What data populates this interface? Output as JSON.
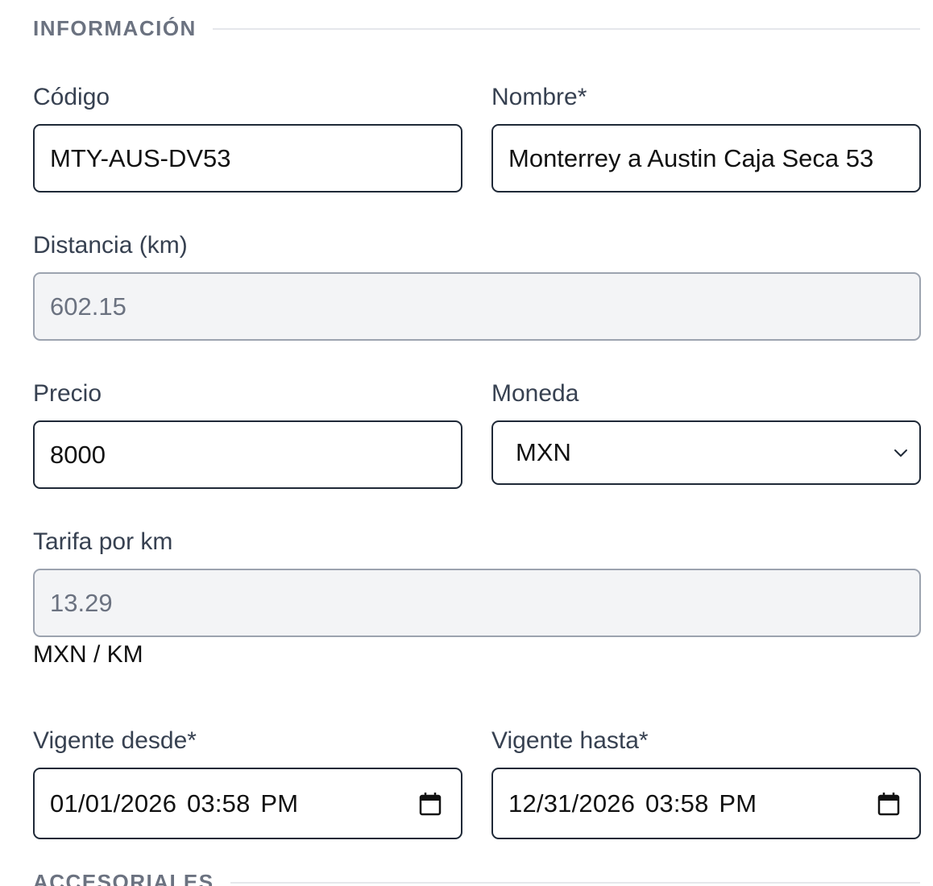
{
  "sections": {
    "informacion": "INFORMACIÓN",
    "accesoriales": "ACCESORIALES"
  },
  "fields": {
    "codigo": {
      "label": "Código",
      "value": "MTY-AUS-DV53"
    },
    "nombre": {
      "label": "Nombre*",
      "value": "Monterrey a Austin Caja Seca 53"
    },
    "distancia": {
      "label": "Distancia (km)",
      "value": "602.15"
    },
    "precio": {
      "label": "Precio",
      "value": "8000"
    },
    "moneda": {
      "label": "Moneda",
      "value": "MXN"
    },
    "tarifa": {
      "label": "Tarifa por km",
      "value": "13.29",
      "unit": "MXN / KM"
    },
    "vigente_desde": {
      "label": "Vigente desde*",
      "value": "01/01/2026 03:58 PM"
    },
    "vigente_hasta": {
      "label": "Vigente hasta*",
      "value": "12/31/2026 03:58 PM"
    }
  },
  "icons": {
    "select_chevron": "chevron-down-icon",
    "date_picker": "calendar-icon"
  },
  "colors": {
    "border": "#1f2937",
    "readonly_bg": "#f3f4f6",
    "section_title": "#6b7280",
    "rule": "#e5e7eb"
  }
}
